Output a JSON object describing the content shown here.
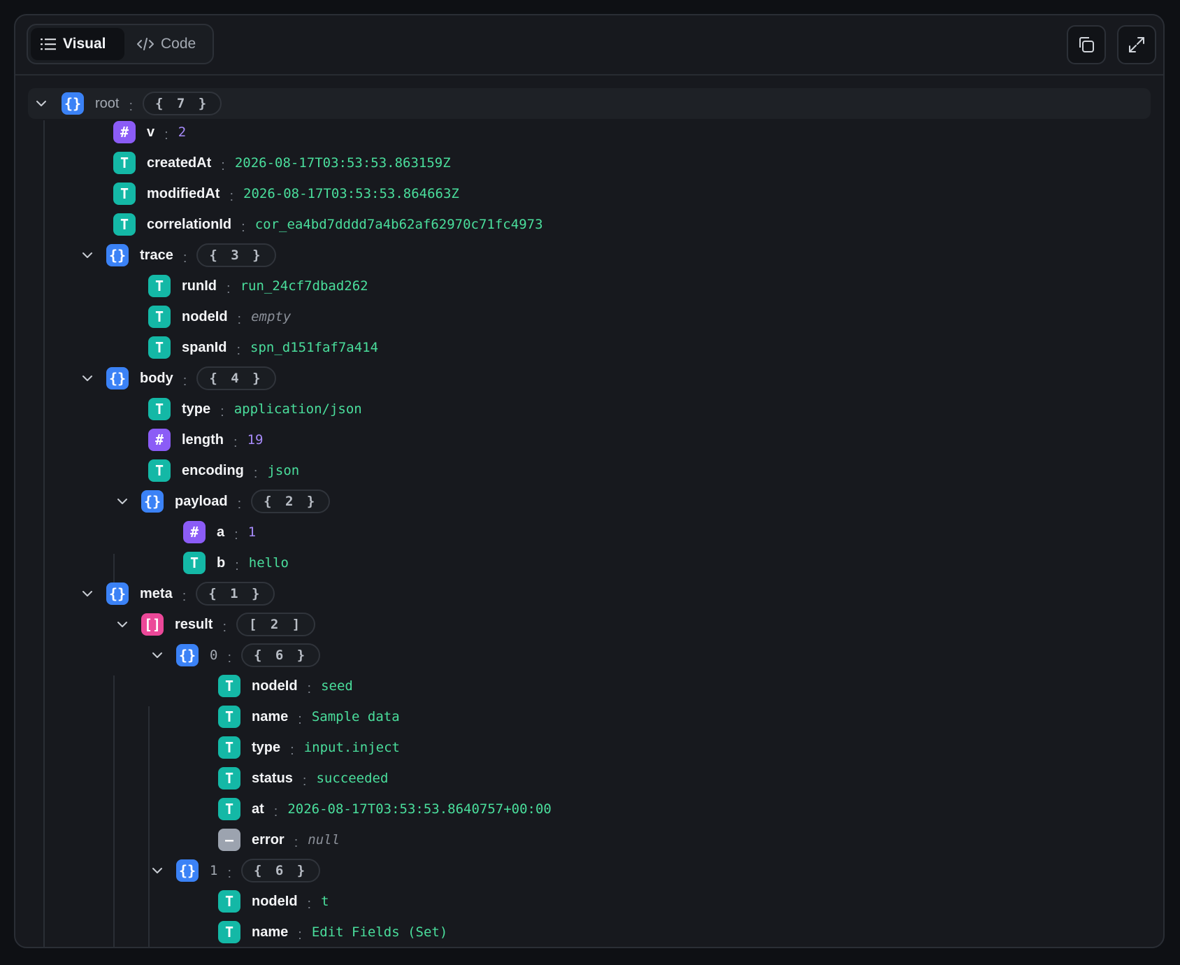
{
  "toolbar": {
    "visual_label": "Visual",
    "code_label": "Code"
  },
  "tree": {
    "root": {
      "key": "root",
      "count": "{ 7 }"
    },
    "v": {
      "key": "v",
      "value": "2"
    },
    "createdAt": {
      "key": "createdAt",
      "value": "2026-08-17T03:53:53.863159Z"
    },
    "modifiedAt": {
      "key": "modifiedAt",
      "value": "2026-08-17T03:53:53.864663Z"
    },
    "correlationId": {
      "key": "correlationId",
      "value": "cor_ea4bd7dddd7a4b62af62970c71fc4973"
    },
    "trace": {
      "key": "trace",
      "count": "{ 3 }",
      "runId": {
        "key": "runId",
        "value": "run_24cf7dbad262"
      },
      "nodeId": {
        "key": "nodeId",
        "value": "empty"
      },
      "spanId": {
        "key": "spanId",
        "value": "spn_d151faf7a414"
      }
    },
    "body": {
      "key": "body",
      "count": "{ 4 }",
      "type": {
        "key": "type",
        "value": "application/json"
      },
      "length": {
        "key": "length",
        "value": "19"
      },
      "encoding": {
        "key": "encoding",
        "value": "json"
      },
      "payload": {
        "key": "payload",
        "count": "{ 2 }",
        "a": {
          "key": "a",
          "value": "1"
        },
        "b": {
          "key": "b",
          "value": "hello"
        }
      }
    },
    "meta": {
      "key": "meta",
      "count": "{ 1 }",
      "result": {
        "key": "result",
        "count": "[ 2 ]",
        "item0": {
          "key": "0",
          "count": "{ 6 }",
          "nodeId": {
            "key": "nodeId",
            "value": "seed"
          },
          "name": {
            "key": "name",
            "value": "Sample data"
          },
          "type": {
            "key": "type",
            "value": "input.inject"
          },
          "status": {
            "key": "status",
            "value": "succeeded"
          },
          "at": {
            "key": "at",
            "value": "2026-08-17T03:53:53.8640757+00:00"
          },
          "error": {
            "key": "error",
            "value": "null"
          }
        },
        "item1": {
          "key": "1",
          "count": "{ 6 }",
          "nodeId": {
            "key": "nodeId",
            "value": "t"
          },
          "name": {
            "key": "name",
            "value": "Edit Fields (Set)"
          }
        }
      }
    }
  },
  "icons": {
    "object": "{}",
    "string": "T",
    "number": "#",
    "array": "[]",
    "null": "—"
  },
  "colors": {
    "background": "#17191e",
    "object": "#3b82f6",
    "string": "#14b8a6",
    "number": "#8b5cf6",
    "array": "#ec4899",
    "null": "#9ca3af",
    "string_value": "#4ade9c",
    "number_value": "#a78bfa"
  }
}
